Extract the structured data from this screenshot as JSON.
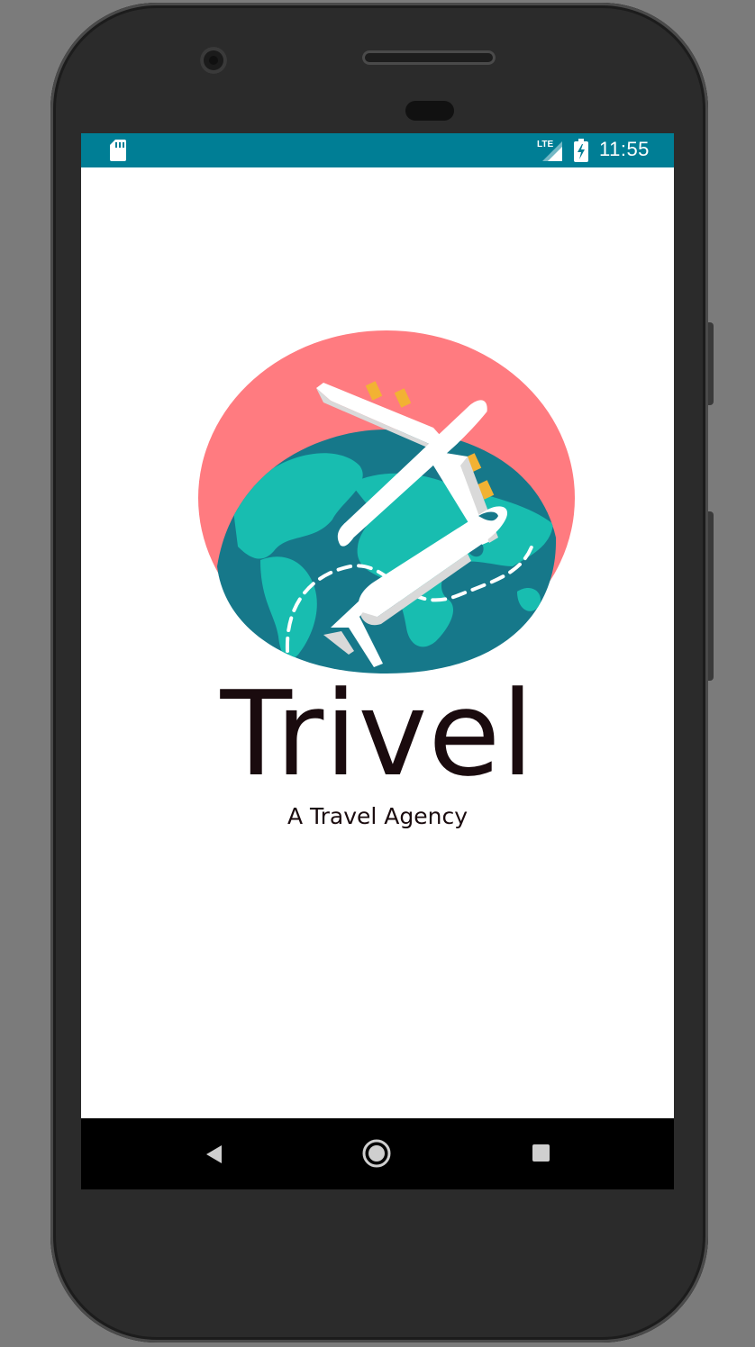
{
  "status_bar": {
    "time": "11:55",
    "network_label": "LTE",
    "icons": [
      "sd-card-icon",
      "lte-signal-icon",
      "battery-charging-icon"
    ],
    "background_color": "#007e95"
  },
  "splash": {
    "title": "Trivel",
    "subtitle": "A Travel Agency",
    "logo": "airplane-over-globe-logo",
    "colors": {
      "circle": "#ff7b80",
      "ocean": "#16788a",
      "land": "#18bdb0",
      "plane": "#ffffff",
      "plane_windows": "#f2b233"
    }
  },
  "nav_bar": {
    "icons": [
      "back-icon",
      "home-icon",
      "recents-icon"
    ]
  }
}
